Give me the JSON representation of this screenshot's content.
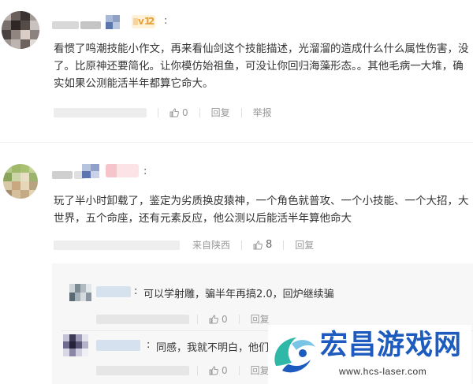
{
  "comments": [
    {
      "level_badge": "2",
      "colon": ":",
      "text_lines": [
        "看惯了鸣潮技能小作文，再来看仙剑这个技能描述，光溜溜的造成什么什么属性伤害，没",
        "了。比原神还要简化。让你模仿始祖鱼，可没让你回归海藻形态。。其他毛病一大堆，确",
        "实如果公测能活半年都算它命大。"
      ],
      "like_count": "0",
      "reply_label": "回复",
      "report_label": "举报"
    },
    {
      "colon": ":",
      "text_lines": [
        "玩了半小时卸载了，鉴定为劣质换皮猿神，一个角色就普攻、一个小技能、一个大招，大",
        "世界，五个命座，还有元素反应，他公测以后能活半年算他命大"
      ],
      "location": "来自陕西",
      "like_count": "8",
      "reply_label": "回复",
      "replies": [
        {
          "colon": ":",
          "text": "可以学射雕，骗半年再搞2.0，回炉继续骗",
          "like_count": "0",
          "reply_label": "回复"
        },
        {
          "colon": ":",
          "text": "同感，我就不明白，他们",
          "like_count": "0",
          "reply_label": "回复"
        }
      ]
    }
  ],
  "watermark": {
    "title": "宏昌游戏网",
    "url": "www.hcs-laser.com"
  },
  "colors": {
    "text": "#333333",
    "meta": "#999999",
    "badge": "#f5a623",
    "watermark_blue": "#1d5bbf",
    "watermark_teal": "#2fb8a8"
  }
}
